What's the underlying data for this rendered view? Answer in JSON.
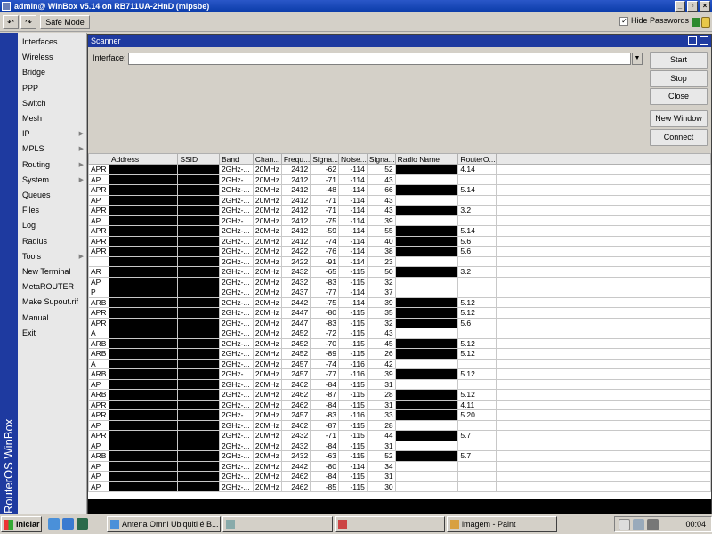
{
  "window": {
    "title": "admin@                       WinBox v5.14 on RB711UA-2HnD (mipsbe)",
    "min": "_",
    "max": "▫",
    "close": "×"
  },
  "toolbar": {
    "undo": "↶",
    "redo": "↷",
    "safe_mode": "Safe Mode",
    "hide_passwords": "Hide Passwords",
    "hide_passwords_checked": "✓"
  },
  "sideband": {
    "text": "RouterOS WinBox"
  },
  "menu": [
    {
      "label": "Interfaces",
      "arrow": ""
    },
    {
      "label": "Wireless",
      "arrow": ""
    },
    {
      "label": "Bridge",
      "arrow": ""
    },
    {
      "label": "PPP",
      "arrow": ""
    },
    {
      "label": "Switch",
      "arrow": ""
    },
    {
      "label": "Mesh",
      "arrow": ""
    },
    {
      "label": "IP",
      "arrow": "▶"
    },
    {
      "label": "MPLS",
      "arrow": "▶"
    },
    {
      "label": "Routing",
      "arrow": "▶"
    },
    {
      "label": "System",
      "arrow": "▶"
    },
    {
      "label": "Queues",
      "arrow": ""
    },
    {
      "label": "Files",
      "arrow": ""
    },
    {
      "label": "Log",
      "arrow": ""
    },
    {
      "label": "Radius",
      "arrow": ""
    },
    {
      "label": "Tools",
      "arrow": "▶"
    },
    {
      "label": "New Terminal",
      "arrow": ""
    },
    {
      "label": "MetaROUTER",
      "arrow": ""
    },
    {
      "label": "Make Supout.rif",
      "arrow": ""
    },
    {
      "label": "Manual",
      "arrow": ""
    },
    {
      "label": "Exit",
      "arrow": ""
    }
  ],
  "scanner": {
    "title": "Scanner",
    "interface_label": "Interface:",
    "interface_value": ".",
    "drop_icon": "▼",
    "buttons": {
      "start": "Start",
      "stop": "Stop",
      "close": "Close",
      "new_window": "New Window",
      "connect": "Connect"
    },
    "columns": [
      "",
      "Address",
      "SSID",
      "Band",
      "Chan...",
      "Frequ...",
      "Signa...",
      "Noise...",
      "Signa...",
      "Radio Name",
      "RouterO..."
    ],
    "rows": [
      [
        "APR",
        "2GHz-...",
        "20MHz",
        "2412",
        "-62",
        "-114",
        "52",
        "4.14"
      ],
      [
        "AP",
        "2GHz-...",
        "20MHz",
        "2412",
        "-71",
        "-114",
        "43",
        ""
      ],
      [
        "APR",
        "2GHz-...",
        "20MHz",
        "2412",
        "-48",
        "-114",
        "66",
        "5.14"
      ],
      [
        "AP",
        "2GHz-...",
        "20MHz",
        "2412",
        "-71",
        "-114",
        "43",
        ""
      ],
      [
        "APR",
        "2GHz-...",
        "20MHz",
        "2412",
        "-71",
        "-114",
        "43",
        "3.2"
      ],
      [
        "AP",
        "2GHz-...",
        "20MHz",
        "2412",
        "-75",
        "-114",
        "39",
        ""
      ],
      [
        "APR",
        "2GHz-...",
        "20MHz",
        "2412",
        "-59",
        "-114",
        "55",
        "5.14"
      ],
      [
        "APR",
        "2GHz-...",
        "20MHz",
        "2412",
        "-74",
        "-114",
        "40",
        "5.6"
      ],
      [
        "APR",
        "2GHz-...",
        "20MHz",
        "2422",
        "-76",
        "-114",
        "38",
        "5.6"
      ],
      [
        "",
        "2GHz-...",
        "20MHz",
        "2422",
        "-91",
        "-114",
        "23",
        ""
      ],
      [
        "AR",
        "2GHz-...",
        "20MHz",
        "2432",
        "-65",
        "-115",
        "50",
        "3.2"
      ],
      [
        "AP",
        "2GHz-...",
        "20MHz",
        "2432",
        "-83",
        "-115",
        "32",
        ""
      ],
      [
        "P",
        "2GHz-...",
        "20MHz",
        "2437",
        "-77",
        "-114",
        "37",
        ""
      ],
      [
        "ARB",
        "2GHz-...",
        "20MHz",
        "2442",
        "-75",
        "-114",
        "39",
        "5.12"
      ],
      [
        "APR",
        "2GHz-...",
        "20MHz",
        "2447",
        "-80",
        "-115",
        "35",
        "5.12"
      ],
      [
        "APR",
        "2GHz-...",
        "20MHz",
        "2447",
        "-83",
        "-115",
        "32",
        "5.6"
      ],
      [
        "A",
        "2GHz-...",
        "20MHz",
        "2452",
        "-72",
        "-115",
        "43",
        ""
      ],
      [
        "ARB",
        "2GHz-...",
        "20MHz",
        "2452",
        "-70",
        "-115",
        "45",
        "5.12"
      ],
      [
        "ARB",
        "2GHz-...",
        "20MHz",
        "2452",
        "-89",
        "-115",
        "26",
        "5.12"
      ],
      [
        "A",
        "2GHz-...",
        "20MHz",
        "2457",
        "-74",
        "-116",
        "42",
        ""
      ],
      [
        "ARB",
        "2GHz-...",
        "20MHz",
        "2457",
        "-77",
        "-116",
        "39",
        "5.12"
      ],
      [
        "AP",
        "2GHz-...",
        "20MHz",
        "2462",
        "-84",
        "-115",
        "31",
        ""
      ],
      [
        "ARB",
        "2GHz-...",
        "20MHz",
        "2462",
        "-87",
        "-115",
        "28",
        "5.12"
      ],
      [
        "APR",
        "2GHz-...",
        "20MHz",
        "2462",
        "-84",
        "-115",
        "31",
        "4.11"
      ],
      [
        "APR",
        "2GHz-...",
        "20MHz",
        "2457",
        "-83",
        "-116",
        "33",
        "5.20"
      ],
      [
        "AP",
        "2GHz-...",
        "20MHz",
        "2462",
        "-87",
        "-115",
        "28",
        ""
      ],
      [
        "APR",
        "2GHz-...",
        "20MHz",
        "2432",
        "-71",
        "-115",
        "44",
        "5.7"
      ],
      [
        "AP",
        "2GHz-...",
        "20MHz",
        "2432",
        "-84",
        "-115",
        "31",
        ""
      ],
      [
        "ARB",
        "2GHz-...",
        "20MHz",
        "2432",
        "-63",
        "-115",
        "52",
        "5.7"
      ],
      [
        "AP",
        "2GHz-...",
        "20MHz",
        "2442",
        "-80",
        "-114",
        "34",
        ""
      ],
      [
        "AP",
        "2GHz-...",
        "20MHz",
        "2462",
        "-84",
        "-115",
        "31",
        ""
      ],
      [
        "AP",
        "2GHz-...",
        "20MHz",
        "2462",
        "-85",
        "-115",
        "30",
        ""
      ]
    ],
    "radio_name_redacted": [
      true,
      false,
      true,
      false,
      true,
      false,
      true,
      true,
      true,
      false,
      true,
      false,
      false,
      true,
      true,
      true,
      false,
      true,
      true,
      false,
      true,
      false,
      true,
      true,
      true,
      false,
      true,
      false,
      true,
      false,
      false,
      false
    ]
  },
  "taskbar": {
    "start": "Iniciar",
    "tasks": [
      {
        "label": "Antena Omni Ubiquiti é B..."
      },
      {
        "label": "            "
      },
      {
        "label": "            "
      },
      {
        "label": "imagem - Paint"
      }
    ],
    "clock": "00:04"
  },
  "colors": {
    "titlebar": "#0a3ba8",
    "sideband": "#1e3aa0",
    "redaction": "#000000"
  }
}
